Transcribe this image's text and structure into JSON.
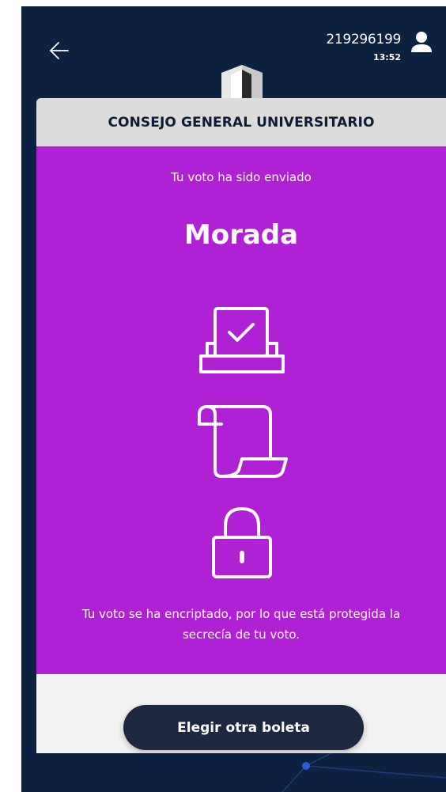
{
  "header": {
    "user_id": "219296199",
    "time": "13:52"
  },
  "card": {
    "title": "CONSEJO GENERAL UNIVERSITARIO",
    "sent_message": "Tu voto ha sido enviado",
    "selected_choice": "Morada",
    "icons": [
      "ballot-box-check-icon",
      "scroll-icon",
      "lock-icon"
    ],
    "info_message": "Tu voto se ha encriptado, por lo que está protegida la secrecía de tu voto.",
    "button_label": "Elegir otra boleta"
  },
  "colors": {
    "background": "#0c2140",
    "card_header": "#dcdcdc",
    "card_body": "#b021d6",
    "button": "#1e2740",
    "footer": "#f2f2f2"
  }
}
